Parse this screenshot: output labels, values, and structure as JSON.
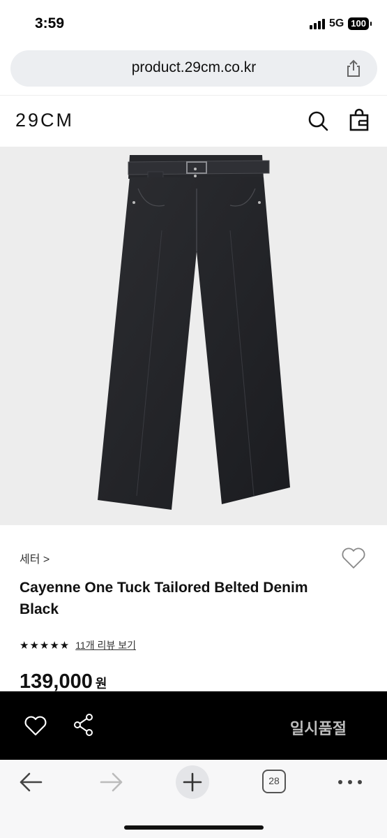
{
  "status": {
    "time": "3:59",
    "network": "5G",
    "battery": "100"
  },
  "browser": {
    "url": "product.29cm.co.kr",
    "tab_count": "28"
  },
  "site": {
    "logo": "29CM"
  },
  "product": {
    "breadcrumb": "세터 >",
    "title": "Cayenne One Tuck Tailored Belted Denim Black",
    "stars": "★★★★★",
    "rating_value": 5,
    "review_link": "11개 리뷰 보기",
    "price": "139,000",
    "currency": "원"
  },
  "actions": {
    "soldout_label": "일시품절"
  },
  "icons": {
    "share": "share-icon",
    "search": "search-icon",
    "bag": "shopping-bag-icon",
    "heart": "heart-icon",
    "share_action": "share-nodes-icon",
    "back": "arrow-left-icon",
    "forward": "arrow-right-icon",
    "new_tab": "plus-icon",
    "more": "more-icon"
  }
}
